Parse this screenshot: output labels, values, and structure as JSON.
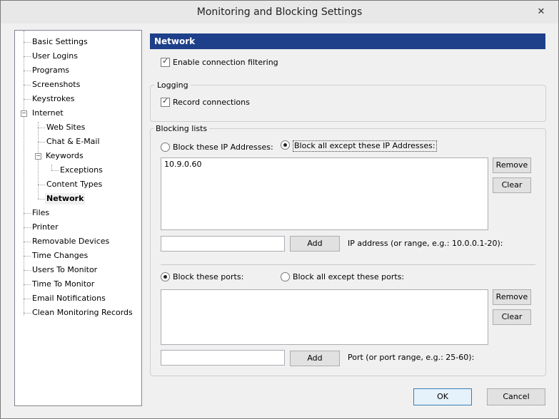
{
  "window": {
    "title": "Monitoring and Blocking Settings",
    "close_glyph": "✕"
  },
  "tree": {
    "items": [
      {
        "label": "Basic Settings"
      },
      {
        "label": "User Logins"
      },
      {
        "label": "Programs"
      },
      {
        "label": "Screenshots"
      },
      {
        "label": "Keystrokes"
      },
      {
        "label": "Internet",
        "expanded": true
      },
      {
        "label": "Web Sites"
      },
      {
        "label": "Chat & E-Mail"
      },
      {
        "label": "Keywords",
        "expanded": true
      },
      {
        "label": "Exceptions"
      },
      {
        "label": "Content Types"
      },
      {
        "label": "Network",
        "selected": true
      },
      {
        "label": "Files"
      },
      {
        "label": "Printer"
      },
      {
        "label": "Removable Devices"
      },
      {
        "label": "Time Changes"
      },
      {
        "label": "Users To Monitor"
      },
      {
        "label": "Time To Monitor"
      },
      {
        "label": "Email Notifications"
      },
      {
        "label": "Clean Monitoring Records"
      }
    ],
    "toggle_glyph": "−"
  },
  "panel": {
    "header": "Network",
    "enable_filtering": {
      "label": "Enable connection filtering",
      "checked": true
    },
    "logging": {
      "title": "Logging",
      "record_connections": {
        "label": "Record connections",
        "checked": true
      }
    },
    "blocking": {
      "title": "Blocking lists",
      "ip": {
        "radio_block_these": "Block these IP Addresses:",
        "radio_block_all_except": "Block all except these IP Addresses:",
        "selected": "block_all_except",
        "entries": [
          "10.9.0.60"
        ],
        "remove_label": "Remove",
        "clear_label": "Clear",
        "input_value": "",
        "add_label": "Add",
        "hint": "IP address (or range, e.g.: 10.0.0.1-20):"
      },
      "ports": {
        "radio_block_these": "Block these ports:",
        "radio_block_all_except": "Block all except these ports:",
        "selected": "block_these",
        "entries": [],
        "remove_label": "Remove",
        "clear_label": "Clear",
        "input_value": "",
        "add_label": "Add",
        "hint": "Port (or port range, e.g.: 25-60):"
      }
    }
  },
  "footer": {
    "ok_label": "OK",
    "cancel_label": "Cancel"
  }
}
